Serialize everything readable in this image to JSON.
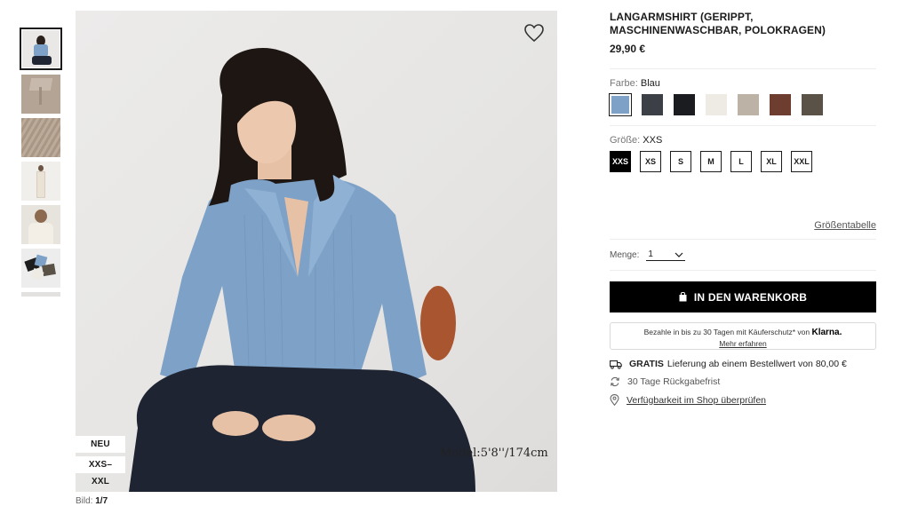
{
  "product": {
    "title": "LANGARMSHIRT (GERIPPT, MASCHINENWASCHBAR, POLOKRAGEN)",
    "price": "29,90 €"
  },
  "gallery": {
    "badge_new": "NEU",
    "badge_sizes": "XXS–XXL",
    "model_info": "Model:5'8''/174cm",
    "counter_label": "Bild:",
    "counter_value": "1/7",
    "thumbnails": [
      "model-front",
      "collar-detail",
      "knit-texture",
      "full-body",
      "model-cream",
      "color-variants"
    ]
  },
  "color": {
    "label": "Farbe:",
    "selected": "Blau",
    "swatches": [
      {
        "name": "Blau",
        "hex": "#7ea2c7"
      },
      {
        "name": "Dunkelgrau",
        "hex": "#3c4046"
      },
      {
        "name": "Schwarz",
        "hex": "#1b1c1f"
      },
      {
        "name": "Off White",
        "hex": "#eeebe4"
      },
      {
        "name": "Beige",
        "hex": "#bdb2a6"
      },
      {
        "name": "Braun",
        "hex": "#6d3d30"
      },
      {
        "name": "Oliv",
        "hex": "#5a5247"
      }
    ]
  },
  "size": {
    "label": "Größe:",
    "selected": "XXS",
    "options": [
      "XXS",
      "XS",
      "S",
      "M",
      "L",
      "XL",
      "XXL"
    ],
    "size_table_link": "Größentabelle"
  },
  "quantity": {
    "label": "Menge:",
    "value": "1"
  },
  "cart": {
    "button_label": "IN DEN WARENKORB"
  },
  "klarna": {
    "text": "Bezahle in bis zu 30 Tagen mit Käuferschutz* von",
    "brand": "Klarna.",
    "more_link": "Mehr erfahren"
  },
  "shipping": {
    "free_bold": "GRATIS",
    "free_text": "Lieferung ab einem Bestellwert von 80,00 €",
    "returns": "30 Tage Rückgabefrist",
    "store_check": "Verfügbarkeit im Shop überprüfen"
  }
}
